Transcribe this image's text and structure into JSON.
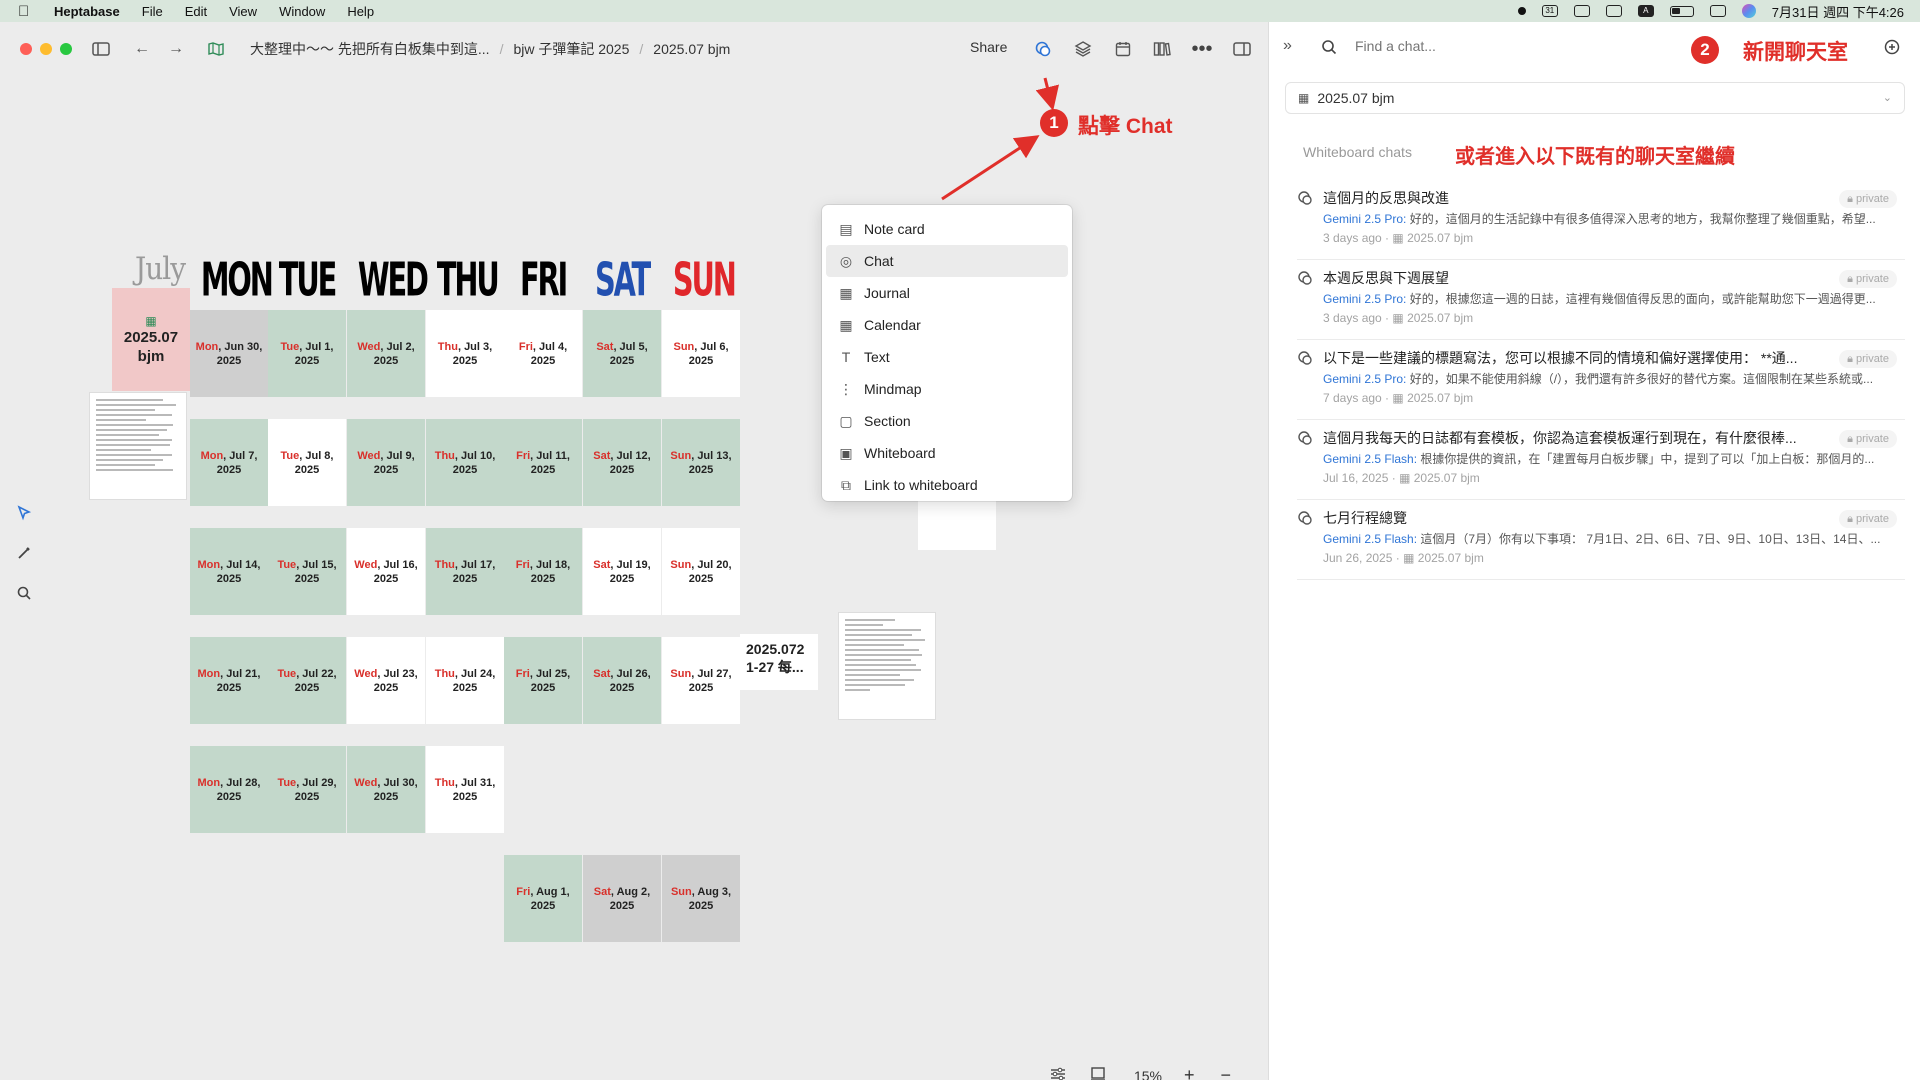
{
  "menubar": {
    "app": "Heptabase",
    "items": [
      "File",
      "Edit",
      "View",
      "Window",
      "Help"
    ],
    "date_time": "7月31日 週四 下午4:26",
    "cal_icon_text": "31",
    "a_icon_text": "A"
  },
  "titlebar": {
    "breadcrumbs": [
      "大整理中～～ 先把所有白板集中到這...",
      "bjw 子彈筆記 2025",
      "2025.07 bjm"
    ],
    "share_label": "Share"
  },
  "calendar": {
    "month": "July",
    "day_headers": [
      {
        "label": "MON",
        "color": "#000000"
      },
      {
        "label": "TUE",
        "color": "#000000"
      },
      {
        "label": "WED",
        "color": "#000000"
      },
      {
        "label": "THU",
        "color": "#000000"
      },
      {
        "label": "FRI",
        "color": "#000000"
      },
      {
        "label": "SAT",
        "color": "#2250b0"
      },
      {
        "label": "SUN",
        "color": "#e0272b"
      }
    ],
    "board_cell": {
      "line1": "2025.07",
      "line2": "bjm"
    },
    "cells": [
      {
        "col": 0,
        "row": 0,
        "day": "Mon",
        "date": ", Jun 30,",
        "year": "2025",
        "bg": "d"
      },
      {
        "col": 1,
        "row": 0,
        "day": "Tue",
        "date": ", Jul 1,",
        "year": "2025",
        "bg": "g"
      },
      {
        "col": 2,
        "row": 0,
        "day": "Wed",
        "date": ", Jul 2,",
        "year": "2025",
        "bg": "g"
      },
      {
        "col": 3,
        "row": 0,
        "day": "Thu",
        "date": ", Jul 3,",
        "year": "2025",
        "bg": "w"
      },
      {
        "col": 4,
        "row": 0,
        "day": "Fri",
        "date": ", Jul 4,",
        "year": "2025",
        "bg": "w"
      },
      {
        "col": 5,
        "row": 0,
        "day": "Sat",
        "date": ", Jul 5,",
        "year": "2025",
        "bg": "g"
      },
      {
        "col": 6,
        "row": 0,
        "day": "Sun",
        "date": ", Jul 6,",
        "year": "2025",
        "bg": "w"
      },
      {
        "col": 0,
        "row": 1,
        "day": "Mon",
        "date": ", Jul 7,",
        "year": "2025",
        "bg": "g"
      },
      {
        "col": 1,
        "row": 1,
        "day": "Tue",
        "date": ", Jul 8,",
        "year": "2025",
        "bg": "w"
      },
      {
        "col": 2,
        "row": 1,
        "day": "Wed",
        "date": ", Jul 9,",
        "year": "2025",
        "bg": "g"
      },
      {
        "col": 3,
        "row": 1,
        "day": "Thu",
        "date": ", Jul 10,",
        "year": "2025",
        "bg": "g"
      },
      {
        "col": 4,
        "row": 1,
        "day": "Fri",
        "date": ", Jul 11,",
        "year": "2025",
        "bg": "g"
      },
      {
        "col": 5,
        "row": 1,
        "day": "Sat",
        "date": ", Jul 12,",
        "year": "2025",
        "bg": "g"
      },
      {
        "col": 6,
        "row": 1,
        "day": "Sun",
        "date": ", Jul 13,",
        "year": "2025",
        "bg": "g"
      },
      {
        "col": 0,
        "row": 2,
        "day": "Mon",
        "date": ", Jul 14,",
        "year": "2025",
        "bg": "g"
      },
      {
        "col": 1,
        "row": 2,
        "day": "Tue",
        "date": ", Jul 15,",
        "year": "2025",
        "bg": "g"
      },
      {
        "col": 2,
        "row": 2,
        "day": "Wed",
        "date": ", Jul 16,",
        "year": "2025",
        "bg": "w"
      },
      {
        "col": 3,
        "row": 2,
        "day": "Thu",
        "date": ", Jul 17,",
        "year": "2025",
        "bg": "g"
      },
      {
        "col": 4,
        "row": 2,
        "day": "Fri",
        "date": ", Jul 18,",
        "year": "2025",
        "bg": "g"
      },
      {
        "col": 5,
        "row": 2,
        "day": "Sat",
        "date": ", Jul 19,",
        "year": "2025",
        "bg": "w"
      },
      {
        "col": 6,
        "row": 2,
        "day": "Sun",
        "date": ", Jul 20,",
        "year": "2025",
        "bg": "w"
      },
      {
        "col": 0,
        "row": 3,
        "day": "Mon",
        "date": ", Jul 21,",
        "year": "2025",
        "bg": "g"
      },
      {
        "col": 1,
        "row": 3,
        "day": "Tue",
        "date": ", Jul 22,",
        "year": "2025",
        "bg": "g"
      },
      {
        "col": 2,
        "row": 3,
        "day": "Wed",
        "date": ", Jul 23,",
        "year": "2025",
        "bg": "w"
      },
      {
        "col": 3,
        "row": 3,
        "day": "Thu",
        "date": ", Jul 24,",
        "year": "2025",
        "bg": "w"
      },
      {
        "col": 4,
        "row": 3,
        "day": "Fri",
        "date": ", Jul 25,",
        "year": "2025",
        "bg": "g"
      },
      {
        "col": 5,
        "row": 3,
        "day": "Sat",
        "date": ", Jul 26,",
        "year": "2025",
        "bg": "g"
      },
      {
        "col": 6,
        "row": 3,
        "day": "Sun",
        "date": ", Jul 27,",
        "year": "2025",
        "bg": "w"
      },
      {
        "col": 0,
        "row": 4,
        "day": "Mon",
        "date": ", Jul 28,",
        "year": "2025",
        "bg": "g"
      },
      {
        "col": 1,
        "row": 4,
        "day": "Tue",
        "date": ", Jul 29,",
        "year": "2025",
        "bg": "g"
      },
      {
        "col": 2,
        "row": 4,
        "day": "Wed",
        "date": ", Jul 30,",
        "year": "2025",
        "bg": "g"
      },
      {
        "col": 3,
        "row": 4,
        "day": "Thu",
        "date": ", Jul 31,",
        "year": "2025",
        "bg": "w"
      },
      {
        "col": 4,
        "row": 5,
        "day": "Fri",
        "date": ", Aug 1,",
        "year": "2025",
        "bg": "g"
      },
      {
        "col": 5,
        "row": 5,
        "day": "Sat",
        "date": ", Aug 2,",
        "year": "2025",
        "bg": "d"
      },
      {
        "col": 6,
        "row": 5,
        "day": "Sun",
        "date": ", Aug 3,",
        "year": "2025",
        "bg": "d"
      }
    ],
    "note_block": "2025.072 1-27 每..."
  },
  "dropdown": {
    "items": [
      {
        "label": "Note card",
        "icon": "note-card-icon",
        "glyph": "▤"
      },
      {
        "label": "Chat",
        "icon": "chat-icon",
        "glyph": "◎"
      },
      {
        "label": "Journal",
        "icon": "journal-icon",
        "glyph": "▦"
      },
      {
        "label": "Calendar",
        "icon": "calendar-icon",
        "glyph": "▦"
      },
      {
        "label": "Text",
        "icon": "text-icon",
        "glyph": "T"
      },
      {
        "label": "Mindmap",
        "icon": "mindmap-icon",
        "glyph": "⋮"
      },
      {
        "label": "Section",
        "icon": "section-icon",
        "glyph": "▢"
      },
      {
        "label": "Whiteboard",
        "icon": "whiteboard-icon",
        "glyph": "▣"
      },
      {
        "label": "Link to whiteboard",
        "icon": "link-whiteboard-icon",
        "glyph": "⧉"
      }
    ],
    "selected_index": 1
  },
  "annotations": {
    "step1_number": "1",
    "step1_text": "點擊 Chat",
    "step2_number": "2",
    "step2_text": "新開聊天室",
    "existing_text": "或者進入以下既有的聊天室繼續",
    "color": "#e02f2a"
  },
  "bottombar": {
    "zoom": "15%",
    "plus": "+",
    "minus": "−"
  },
  "panel": {
    "search_placeholder": "Find a chat...",
    "whiteboard_select": "2025.07 bjm",
    "section_label": "Whiteboard chats",
    "chats": [
      {
        "title": "這個月的反思與改進",
        "model": "Gemini 2.5 Pro:",
        "preview": " 好的，這個月的生活記錄中有很多值得深入思考的地方，我幫你整理了幾個重點，希望...",
        "time": "3 days ago",
        "board": "2025.07 bjm",
        "badge": "private"
      },
      {
        "title": "本週反思與下週展望",
        "model": "Gemini 2.5 Pro:",
        "preview": " 好的，根據您這一週的日誌，這裡有幾個值得反思的面向，或許能幫助您下一週過得更...",
        "time": "3 days ago",
        "board": "2025.07 bjm",
        "badge": "private"
      },
      {
        "title": "以下是一些建議的標題寫法，您可以根據不同的情境和偏好選擇使用： **通...",
        "model": "Gemini 2.5 Pro:",
        "preview": " 好的，如果不能使用斜線（/），我們還有許多很好的替代方案。這個限制在某些系統或...",
        "time": "7 days ago",
        "board": "2025.07 bjm",
        "badge": "private"
      },
      {
        "title": "這個月我每天的日誌都有套模板，你認為這套模板運行到現在，有什麼很棒...",
        "model": "Gemini 2.5 Flash:",
        "preview": " 根據你提供的資訊，在「建置每月白板步驟」中，提到了可以「加上白板：那個月的...",
        "time": "Jul 16, 2025",
        "board": "2025.07 bjm",
        "badge": "private"
      },
      {
        "title": "七月行程總覽",
        "model": "Gemini 2.5 Flash:",
        "preview": " 這個月（7月）你有以下事項： 7月1日、2日、6日、7日、9日、10日、13日、14日、...",
        "time": "Jun 26, 2025",
        "board": "2025.07 bjm",
        "badge": "private"
      }
    ]
  }
}
